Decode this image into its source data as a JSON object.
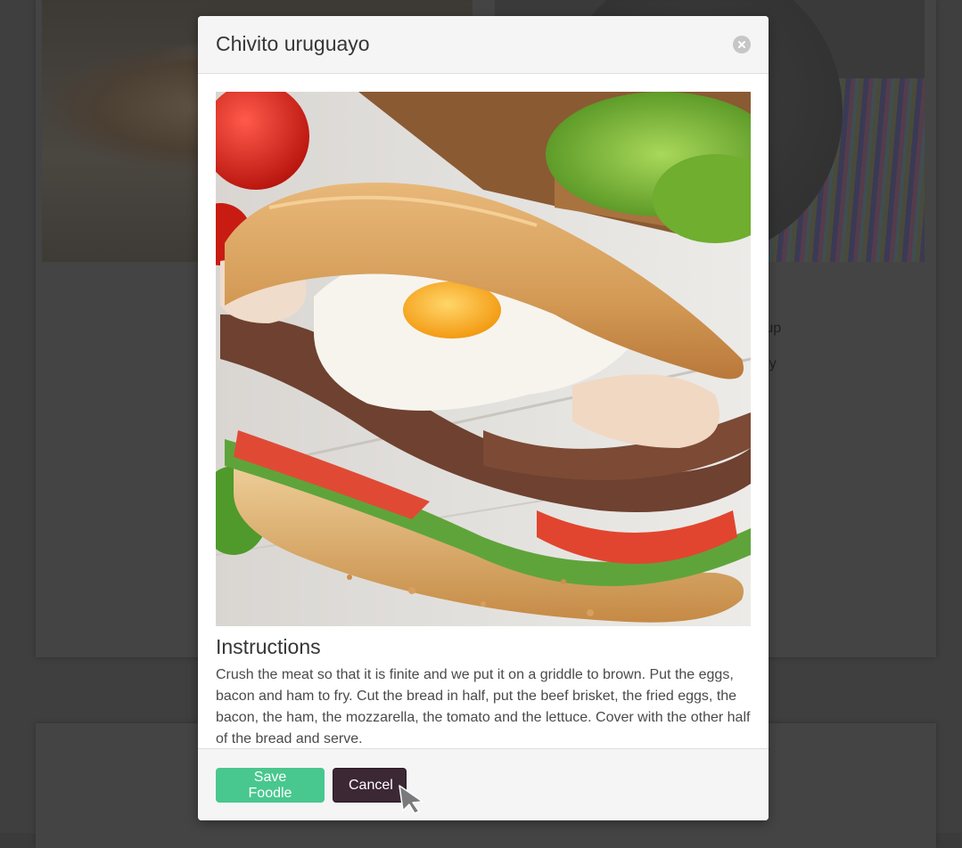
{
  "background": {
    "partial_text_1": "yrup",
    "partial_text_2": "ndy"
  },
  "modal": {
    "title": "Chivito uruguayo",
    "close_icon": "close-icon",
    "image_alt": "Chivito uruguayo sandwich",
    "instructions_heading": "Instructions",
    "instructions_text": "Crush the meat so that it is finite and we put it on a griddle to brown. Put the eggs, bacon and ham to fry. Cut the bread in half, put the beef brisket, the fried eggs, the bacon, the ham, the mozzarella, the tomato and the lettuce. Cover with the other half of the bread and serve.",
    "save_label": "Save Foodle",
    "cancel_label": "Cancel"
  },
  "colors": {
    "save_button": "#48c78e",
    "cancel_button": "#3c2735",
    "overlay": "#3b3b3b"
  }
}
